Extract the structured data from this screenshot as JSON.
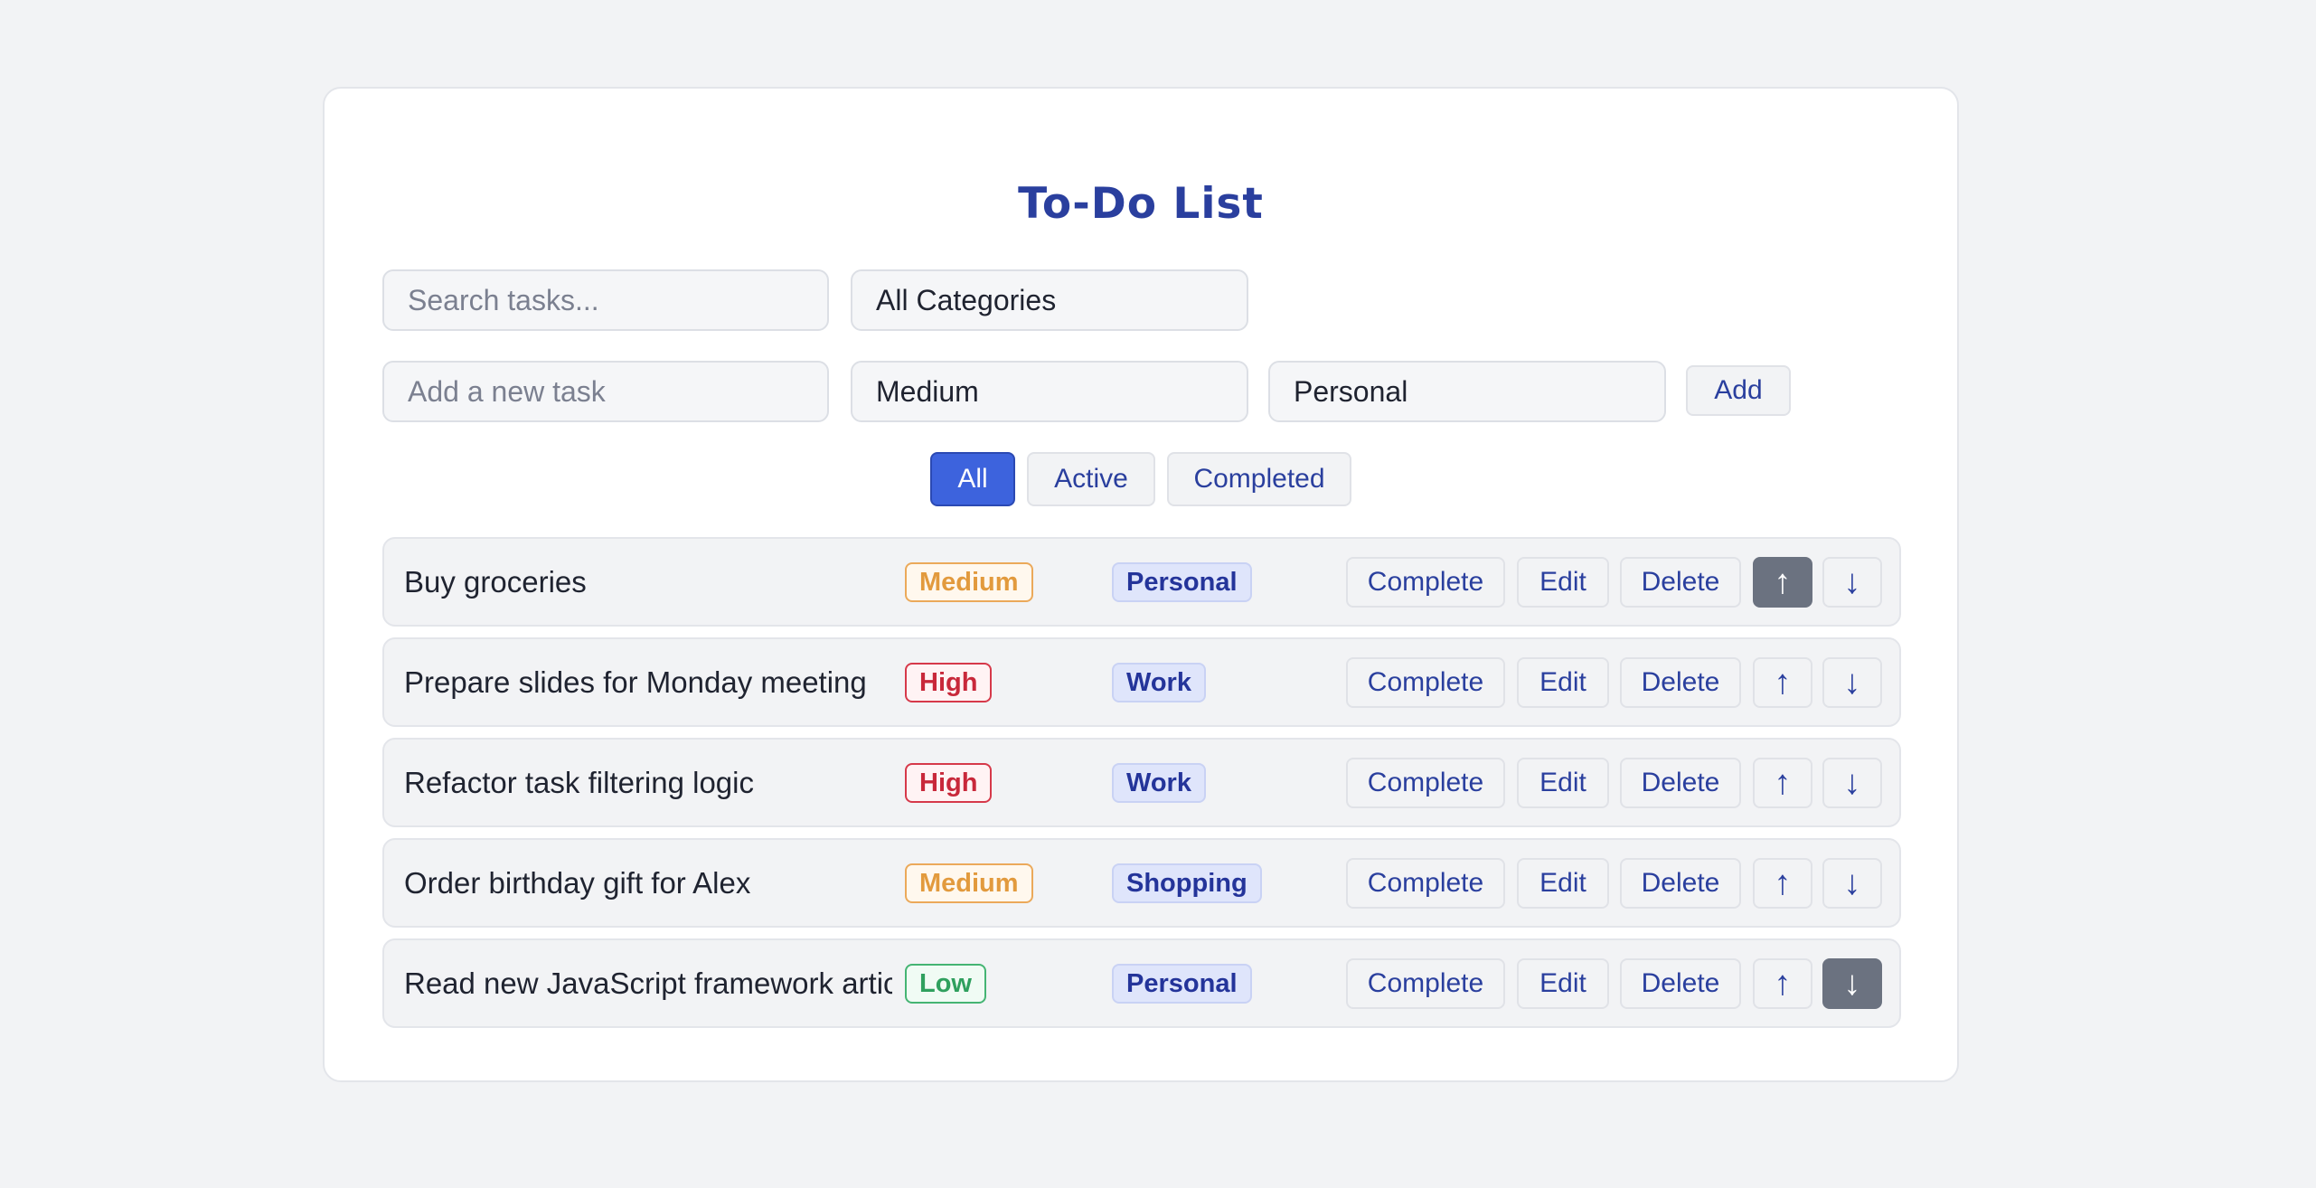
{
  "app": {
    "title": "To-Do List"
  },
  "search": {
    "placeholder": "Search tasks..."
  },
  "category_filter": {
    "selected": "All Categories"
  },
  "new_task": {
    "placeholder": "Add a new task",
    "priority": "Medium",
    "category": "Personal",
    "add_label": "Add"
  },
  "filters": [
    {
      "label": "All",
      "active": true
    },
    {
      "label": "Active",
      "active": false
    },
    {
      "label": "Completed",
      "active": false
    }
  ],
  "actions": {
    "complete": "Complete",
    "edit": "Edit",
    "delete": "Delete",
    "up": "↑",
    "down": "↓"
  },
  "tasks": [
    {
      "text": "Buy groceries",
      "priority": "Medium",
      "category": "Personal"
    },
    {
      "text": "Prepare slides for Monday meeting",
      "priority": "High",
      "category": "Work"
    },
    {
      "text": "Refactor task filtering logic",
      "priority": "High",
      "category": "Work"
    },
    {
      "text": "Order birthday gift for Alex",
      "priority": "Medium",
      "category": "Shopping"
    },
    {
      "text": "Read new JavaScript framework article",
      "priority": "Low",
      "category": "Personal"
    }
  ],
  "colors": {
    "accent": "#3d63dd",
    "title": "#2a3f9e",
    "priority_medium": "#e29a3d",
    "priority_high": "#c8283a",
    "priority_low": "#2fa05e"
  }
}
